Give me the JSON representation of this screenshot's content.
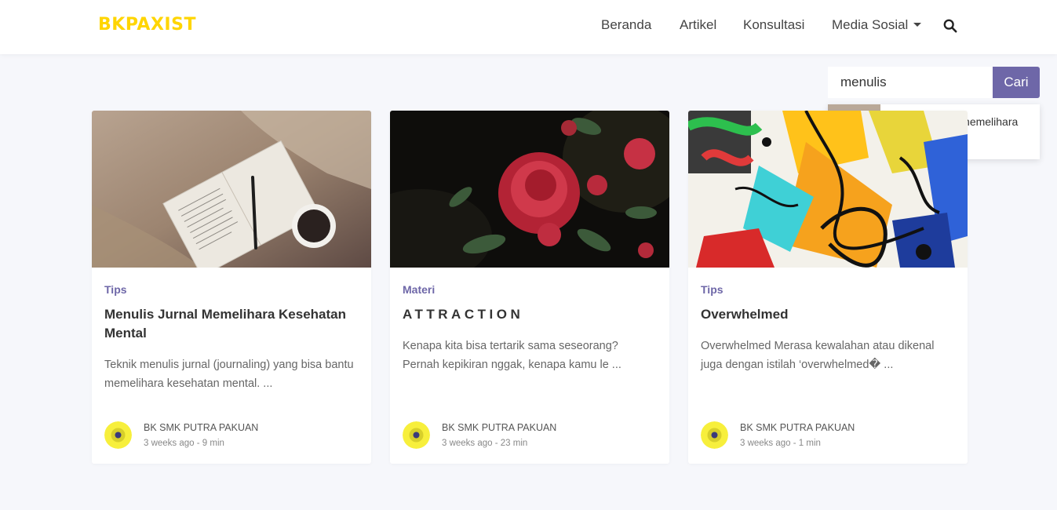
{
  "brand": "BKPAXIST",
  "nav": {
    "items": [
      "Beranda",
      "Artikel",
      "Konsultasi"
    ],
    "dropdown_label": "Media Sosial"
  },
  "search": {
    "value": "menulis",
    "button_label": "Cari",
    "suggestion": "Menulis Jurnal memelihara kesehatan ..."
  },
  "cards": [
    {
      "category": "Tips",
      "title": "Menulis Jurnal Memelihara Kesehatan Mental",
      "excerpt": "Teknik menulis jurnal (journaling) yang bisa bantu memelihara kesehatan mental. ...",
      "author": "BK SMK PUTRA PAKUAN",
      "meta": "3 weeks ago - 9 min"
    },
    {
      "category": "Materi",
      "title": "ATTRACTION",
      "excerpt": "Kenapa kita bisa tertarik sama seseorang? Pernah kepikiran nggak, kenapa kamu le ...",
      "author": "BK SMK PUTRA PAKUAN",
      "meta": "3 weeks ago - 23 min"
    },
    {
      "category": "Tips",
      "title": "Overwhelmed",
      "excerpt": "Overwhelmed  Merasa kewalahan atau dikenal juga dengan istilah ‘overwhelmed� ...",
      "author": "BK SMK PUTRA PAKUAN",
      "meta": "3 weeks ago - 1 min"
    }
  ],
  "colors": {
    "brand": "#ffd500",
    "accent": "#6e67a8",
    "background": "#f6f7fb"
  },
  "icons": [
    "search-icon",
    "caret-down-icon",
    "avatar-logo"
  ]
}
